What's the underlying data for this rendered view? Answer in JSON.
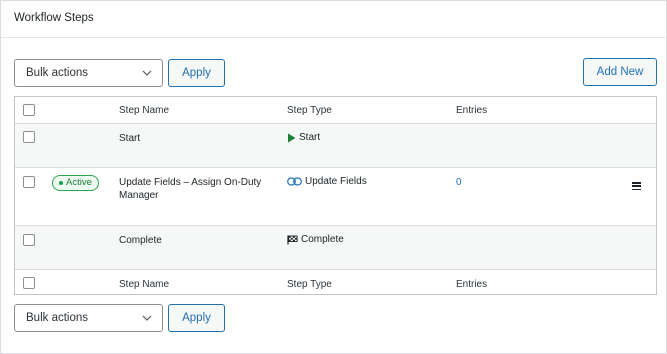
{
  "header": {
    "title": "Workflow Steps"
  },
  "bulk_top": {
    "select_value": "Bulk actions",
    "apply_label": "Apply"
  },
  "add_new_label": "Add New",
  "table": {
    "columns": {
      "name": "Step Name",
      "type": "Step Type",
      "entries": "Entries"
    },
    "rows": [
      {
        "name": "Start",
        "type": "Start",
        "type_icon": "play-icon",
        "entries": "",
        "status": ""
      },
      {
        "name": "Update Fields – Assign On-Duty Manager",
        "type": "Update Fields",
        "type_icon": "link-icon",
        "entries": "0",
        "status": "Active"
      },
      {
        "name": "Complete",
        "type": "Complete",
        "type_icon": "checkered-flag-icon",
        "entries": "",
        "status": ""
      }
    ]
  },
  "bulk_bottom": {
    "select_value": "Bulk actions",
    "apply_label": "Apply"
  },
  "colors": {
    "accent": "#2271b1",
    "start_icon": "#1a7f37",
    "status_active": "#1a7f37"
  }
}
